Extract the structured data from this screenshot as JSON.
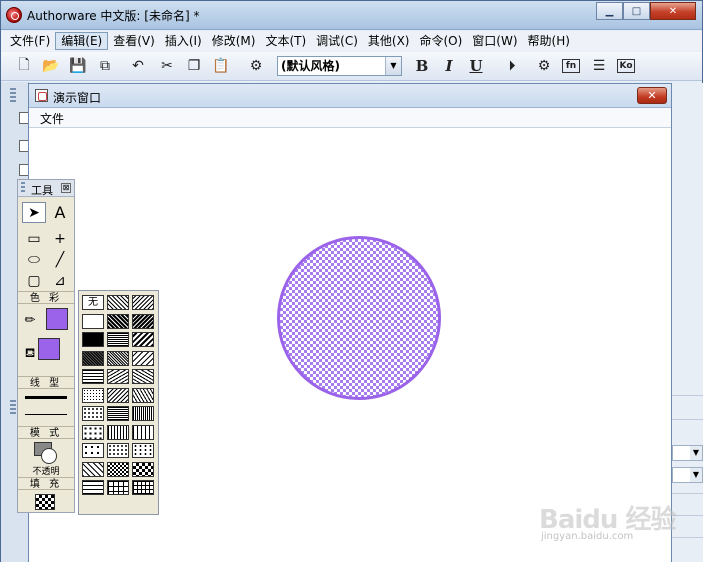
{
  "app": {
    "title": "Authorware 中文版: [未命名] *",
    "controls": {
      "minimize": "▁",
      "maximize": "□",
      "close": "✕"
    }
  },
  "menubar": {
    "items": [
      {
        "label": "文件(F)",
        "active": false
      },
      {
        "label": "编辑(E)",
        "active": true
      },
      {
        "label": "查看(V)",
        "active": false
      },
      {
        "label": "插入(I)",
        "active": false
      },
      {
        "label": "修改(M)",
        "active": false
      },
      {
        "label": "文本(T)",
        "active": false
      },
      {
        "label": "调试(C)",
        "active": false
      },
      {
        "label": "其他(X)",
        "active": false
      },
      {
        "label": "命令(O)",
        "active": false
      },
      {
        "label": "窗口(W)",
        "active": false
      },
      {
        "label": "帮助(H)",
        "active": false
      }
    ]
  },
  "toolbar": {
    "style_value": "(默认风格)",
    "bold": "B",
    "italic": "I",
    "underline": "U",
    "fn_label": "fn",
    "ko_label": "Ko",
    "icons": [
      "new-file-icon",
      "open-folder-icon",
      "save-icon",
      "import-icon",
      "undo-icon",
      "cut-icon",
      "copy-icon",
      "paste-icon",
      "find-icon",
      "run-icon",
      "control-panel-icon",
      "functions-icon",
      "variables-icon",
      "knowledge-objects-icon"
    ]
  },
  "presentation": {
    "title": "演示窗口",
    "menu_file": "文件",
    "close": "✕",
    "shape_color": "#9b63ea"
  },
  "tools": {
    "title": "工具",
    "close": "⊠",
    "text_tool": "A",
    "color_label": "色 彩",
    "line_label": "线 型",
    "mode_label": "模 式",
    "mode_value": "不透明",
    "fill_label": "填 充",
    "fill_color": "#9b63ea"
  },
  "fill_patterns": {
    "none_label": "无"
  },
  "watermark": {
    "text": "Baidu 经验",
    "sub": "jingyan.baidu.com"
  }
}
